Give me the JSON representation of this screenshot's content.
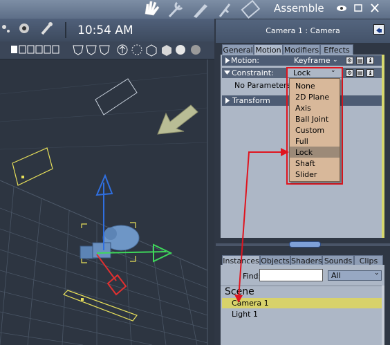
{
  "app": {
    "mode_title": "Assemble",
    "time": "10:54 AM"
  },
  "colors": {
    "highlight_red": "#e0141e",
    "selected_row": "#d8d26a",
    "dropdown_bg": "#d8b89a",
    "panel_bg": "#adb7c6"
  },
  "panel": {
    "header_title": "Camera 1 : Camera",
    "tabs": [
      {
        "label": "General"
      },
      {
        "label": "Motion"
      },
      {
        "label": "Modifiers"
      },
      {
        "label": "Effects"
      }
    ],
    "motion_label": "Motion:",
    "motion_value": "Keyframe",
    "constraint_label": "Constraint:",
    "constraint_value": "Lock",
    "no_params": "No Parameters",
    "transform_label": "Transform"
  },
  "constraint_options": [
    "None",
    "2D Plane",
    "Axis",
    "Ball Joint",
    "Custom",
    "Full",
    "Lock",
    "Shaft",
    "Slider"
  ],
  "constraint_selected": "Lock",
  "browser": {
    "tabs": [
      {
        "label": "Instances"
      },
      {
        "label": "Objects"
      },
      {
        "label": "Shaders"
      },
      {
        "label": "Sounds"
      },
      {
        "label": "Clips"
      }
    ],
    "find_label": "Find:",
    "find_value": "",
    "filter_value": "All",
    "group_title": "Scene",
    "items": [
      "Camera 1",
      "Light 1"
    ],
    "selected_item": "Camera 1"
  }
}
